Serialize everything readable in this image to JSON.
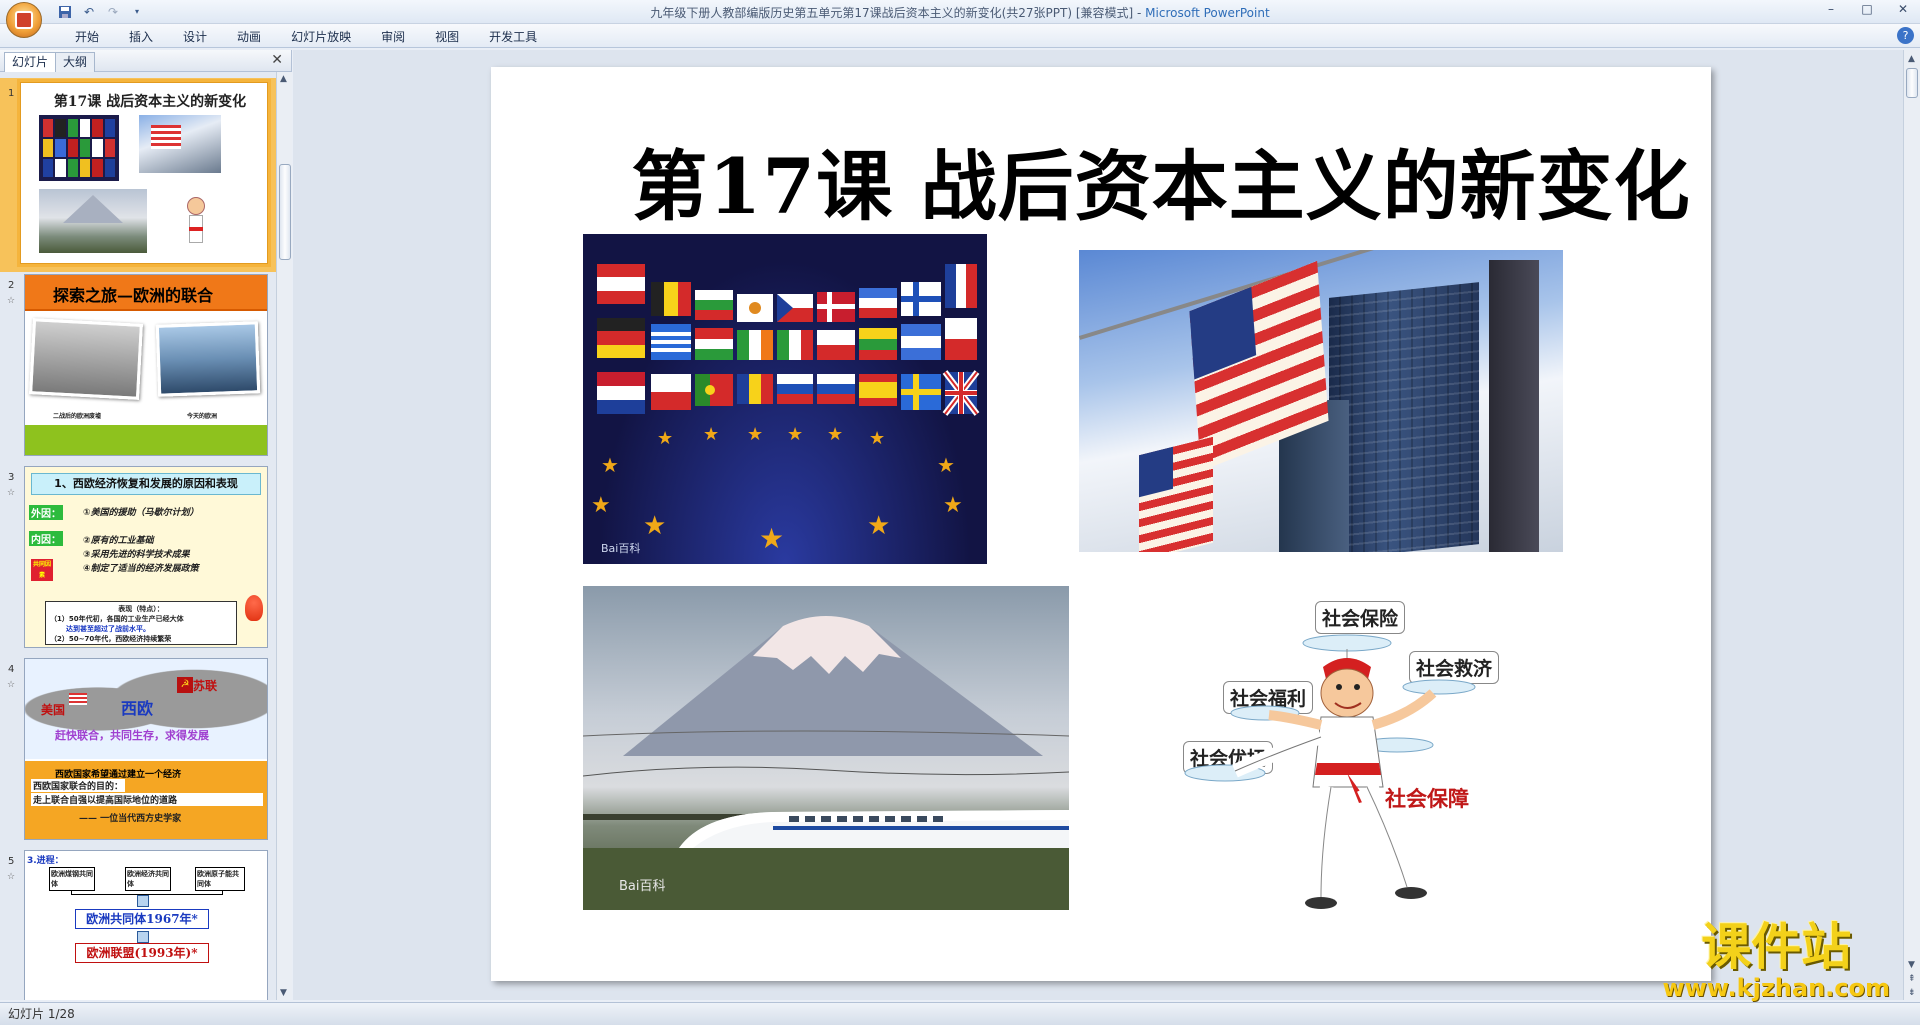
{
  "titlebar": {
    "document_title": "九年级下册人教部编版历史第五单元第17课战后资本主义的新变化(共27张PPT) [兼容模式] -",
    "app_name": "Microsoft PowerPoint",
    "minimize": "–",
    "maximize": "□",
    "close": "✕"
  },
  "ribbon": {
    "tabs": [
      "开始",
      "插入",
      "设计",
      "动画",
      "幻灯片放映",
      "审阅",
      "视图",
      "开发工具"
    ],
    "help": "?"
  },
  "panel": {
    "tab_slides": "幻灯片",
    "tab_outline": "大纲",
    "close": "✕"
  },
  "thumbnails": [
    {
      "number": "1",
      "title": "第17课 战后资本主义的新变化"
    },
    {
      "number": "2",
      "title": "探索之旅—欧洲的联合",
      "caption_left": "二战后的欧洲废墟",
      "caption_right": "今天的欧洲"
    },
    {
      "number": "3",
      "title": "1、西欧经济恢复和发展的原因和表现",
      "label_external": "外因：",
      "label_internal": "内因：",
      "label_cooperate": "共同因素",
      "point1": "①美国的援助（马歇尔计划）",
      "point2": "②原有的工业基础",
      "point3": "③采用先进的科学技术成果",
      "point4": "④制定了适当的经济发展政策",
      "box_title": "表现（特点）：",
      "box_line1": "（1）50年代初，各国的工业生产已经大体",
      "box_line2": "达到甚至超过了战前水平。",
      "box_line3": "（2）50~70年代，西欧经济持续繁荣"
    },
    {
      "number": "4",
      "label_usa": "美国",
      "label_europe": "西欧",
      "label_ussr": "苏联",
      "slogan": "赶快联合，共同生存，求得发展",
      "text1": "西欧国家希望通过建立一个经济",
      "text2": "西欧国家联合的目的：",
      "text3": "走上联合自强以提高国际地位的道路",
      "author": "—— 一位当代西方史学家"
    },
    {
      "number": "5",
      "heading": "3.进程：",
      "org1": "欧洲煤钢共同体",
      "org2": "欧洲经济共同体",
      "org3": "欧洲原子能共同体",
      "ec": "欧洲共同体1967年*",
      "eu": "欧洲联盟(1993年)*"
    }
  ],
  "slide": {
    "title": "第17课 战后资本主义的新变化",
    "social_labels": [
      "社会保险",
      "社会救济",
      "社会福利",
      "社会优抚",
      "社会保障"
    ],
    "baike_mark": "Bai百科"
  },
  "statusbar": {
    "slide_position": "幻灯片 1/28"
  },
  "watermark": {
    "main": "课件站",
    "url": "www.kjzhan.com"
  }
}
